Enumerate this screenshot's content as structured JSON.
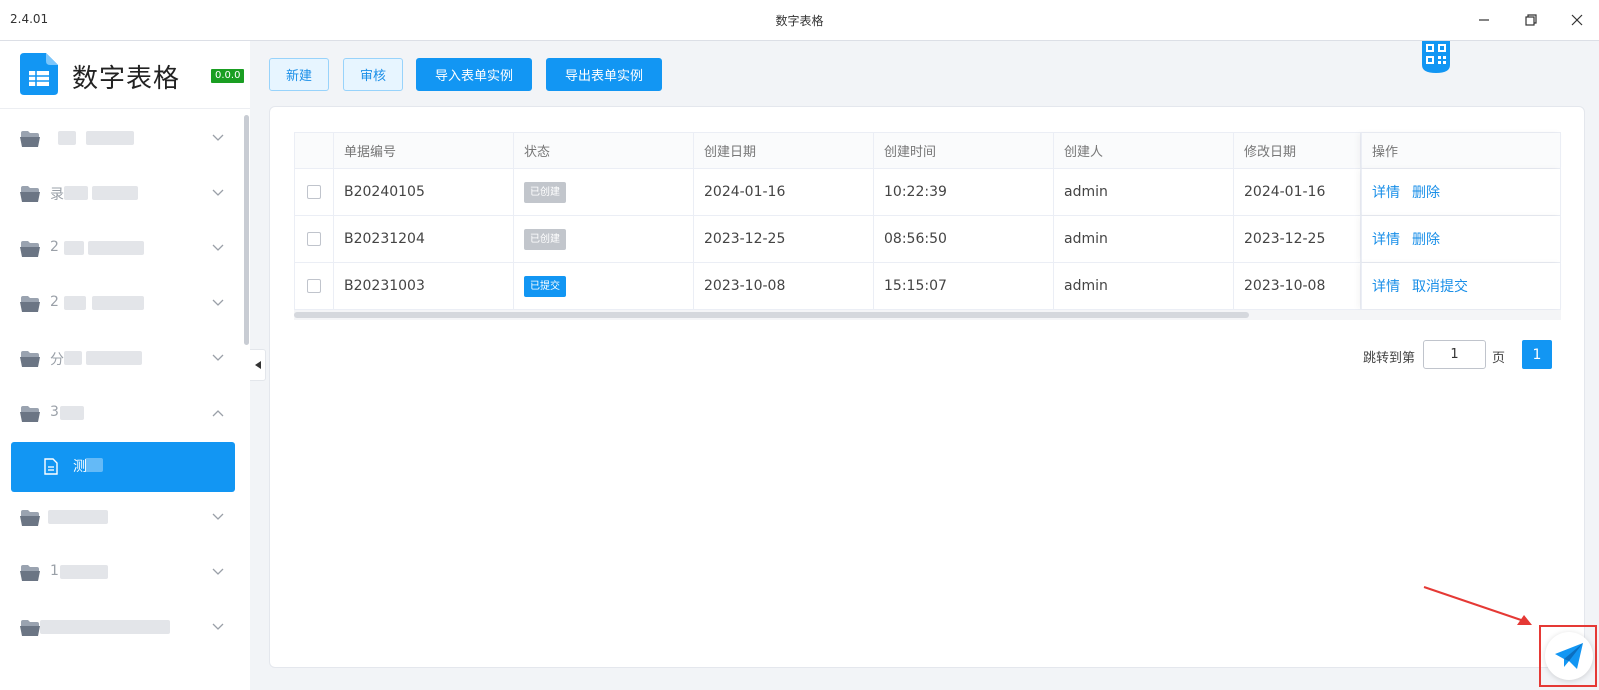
{
  "window": {
    "version": "2.4.01",
    "title": "数字表格"
  },
  "app": {
    "name": "数字表格",
    "version_badge": "0.0.0"
  },
  "sidebar": {
    "items": [
      {
        "label": "",
        "expanded": false
      },
      {
        "label": "录",
        "expanded": false
      },
      {
        "label": "2",
        "expanded": false
      },
      {
        "label": "2",
        "expanded": false
      },
      {
        "label": "分",
        "expanded": false
      },
      {
        "label": "3",
        "expanded": true
      },
      {
        "label": "",
        "expanded": false
      },
      {
        "label": "1",
        "expanded": false
      },
      {
        "label": "",
        "expanded": false
      }
    ],
    "active_item": {
      "label": "测"
    }
  },
  "toolbar": {
    "new_label": "新建",
    "audit_label": "审核",
    "import_label": "导入表单实例",
    "export_label": "导出表单实例"
  },
  "table": {
    "columns": [
      "单据编号",
      "状态",
      "创建日期",
      "创建时间",
      "创建人",
      "修改日期",
      "操作"
    ],
    "rows": [
      {
        "id": "B20240105",
        "status": "已创建",
        "status_type": "gray",
        "create_date": "2024-01-16",
        "create_time": "10:22:39",
        "creator": "admin",
        "modify_date": "2024-01-16",
        "actions": [
          "详情",
          "删除"
        ]
      },
      {
        "id": "B20231204",
        "status": "已创建",
        "status_type": "gray",
        "create_date": "2023-12-25",
        "create_time": "08:56:50",
        "creator": "admin",
        "modify_date": "2023-12-25",
        "actions": [
          "详情",
          "删除"
        ]
      },
      {
        "id": "B20231003",
        "status": "已提交",
        "status_type": "blue",
        "create_date": "2023-10-08",
        "create_time": "15:15:07",
        "creator": "admin",
        "modify_date": "2023-10-08",
        "actions": [
          "详情",
          "取消提交"
        ]
      }
    ]
  },
  "pagination": {
    "jump_label": "跳转到第",
    "jump_value": "1",
    "suffix": "页",
    "current_page": "1"
  },
  "colors": {
    "primary": "#1296f3",
    "badge_green": "#1a9e22",
    "tag_gray": "#c2c6cc",
    "annotation_red": "#e53935"
  },
  "icons": {
    "minimize": "minimize-icon",
    "restore": "restore-icon",
    "close": "close-icon",
    "folder": "folder-icon",
    "document": "document-icon",
    "chevron": "chevron-down-icon",
    "collapse": "caret-left-icon",
    "qr": "qr-code-icon",
    "send": "paper-plane-icon"
  }
}
